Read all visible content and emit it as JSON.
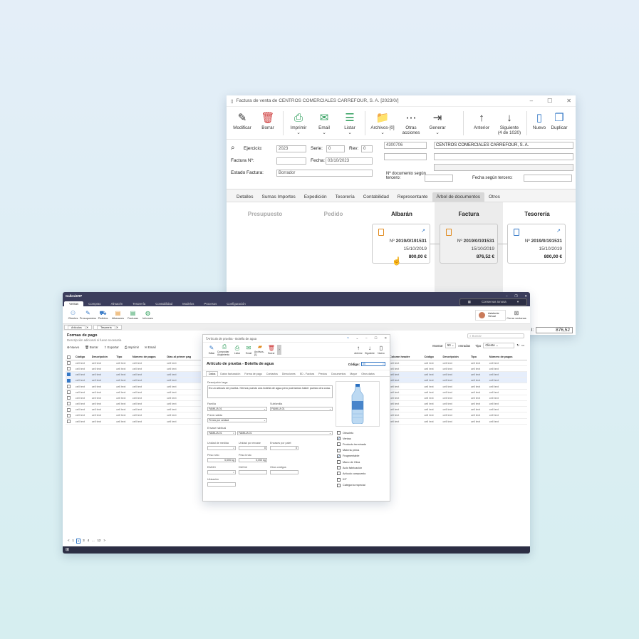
{
  "invoice": {
    "title": "Factura de venta de CENTROS COMERCIALES CARREFOUR, S. A. [2023/0/]",
    "toolbar": [
      {
        "label": "Modificar",
        "icon": "edit-icon",
        "sym": "✎"
      },
      {
        "label": "Borrar",
        "icon": "delete-icon",
        "sym": "🗑"
      },
      {
        "label": "Imprimir",
        "icon": "print-icon",
        "sym": "⎙"
      },
      {
        "label": "Email",
        "icon": "email-icon",
        "sym": "✉"
      },
      {
        "label": "Listar",
        "icon": "list-icon",
        "sym": "☰"
      },
      {
        "label": "Archivos-[0]",
        "icon": "folder-icon",
        "sym": "📁"
      },
      {
        "label": "Otras acciones",
        "icon": "more-icon",
        "sym": "⋯"
      },
      {
        "label": "Generar",
        "icon": "generate-icon",
        "sym": "⇥"
      }
    ],
    "nav": [
      {
        "label": "Anterior",
        "icon": "arrow-up-icon",
        "sym": "↑"
      },
      {
        "label": "Siguiente",
        "icon": "arrow-down-icon",
        "sym": "↓"
      },
      {
        "label": "Nuevo",
        "icon": "new-doc-icon",
        "sym": "▯"
      },
      {
        "label": "Duplicar",
        "icon": "duplicate-icon",
        "sym": "❐"
      }
    ],
    "nav_counter": "(4 de 1020)",
    "form": {
      "ejercicio_label": "Ejercicio:",
      "ejercicio": "2023",
      "serie_label": "Serie:",
      "serie": "0",
      "rev_label": "Rev:",
      "rev": "0",
      "factura_label": "Factura Nº:",
      "factura": "",
      "fecha_label": "Fecha:",
      "fecha": "03/10/2023",
      "estado_label": "Estado Factura:",
      "estado": "Borrador",
      "cliente_code": "4300706",
      "cliente_name": "CENTROS COMERCIALES CARREFOUR, S. A.",
      "ndoc_label": "Nº documento según tercero:",
      "fecha_tercero_label": "Fecha según tercero:"
    },
    "tabs": [
      "Detalles",
      "Sumas Importes",
      "Expedición",
      "Tesorería",
      "Contabilidad",
      "Representante",
      "Árbol de documentos",
      "Otros"
    ],
    "active_tab": "Árbol de documentos",
    "tree": {
      "columns": [
        "Presupuesto",
        "Pedido",
        "Albarán",
        "Factura",
        "Tesorería"
      ],
      "cards": [
        {
          "num_prefix": "Nº ",
          "num": "2019/0/191531",
          "date": "15/10/2019",
          "amount": "800,00 €"
        },
        {
          "num_prefix": "Nº ",
          "num": "2019/0/191531",
          "date": "15/10/2019",
          "amount": "876,52 €"
        },
        {
          "num_prefix": "Nº ",
          "num": "2019/0/191531",
          "date": "15/10/2019",
          "amount": "800,00 €"
        }
      ]
    },
    "total_suffix": "l:",
    "total": "876,52"
  },
  "erp": {
    "app": "GalleniERP",
    "menu": [
      "Ventas",
      "Compras",
      "Almacén",
      "Tesorería",
      "Contabilidad",
      "Modelos",
      "Procesos",
      "Configuración"
    ],
    "ribbon": [
      "Clientes",
      "Presupuestos",
      "Pedidos",
      "Albaranes",
      "Facturas",
      "Informes"
    ],
    "company": "Conservas Ionosa",
    "assistant": "Asistente Virtual",
    "close_label": "Cerrar ventanas",
    "tabs": [
      "Artículos",
      "Tesoreria"
    ],
    "list_title": "Formas de pago",
    "list_subtitle": "Descripción adicional si fuese necesaria",
    "actions": [
      "Nuevo",
      "Borrar",
      "Exportar",
      "Imprimir",
      "Email"
    ],
    "show_label": "Mostrar",
    "show_value": "50",
    "entries_label": "entradas",
    "type_label": "Tipo",
    "type_value": "Cliente",
    "search_placeholder": "Buscar",
    "left_cols": [
      "Código",
      "Descripción",
      "Tipo",
      "Número de pagos",
      "Días al primer pag"
    ],
    "right_cols": [
      "Column header",
      "Código",
      "Descripción",
      "Tipo",
      "Número de pagos"
    ],
    "cell": "cell text",
    "rows": [
      false,
      false,
      true,
      true,
      false,
      false,
      false,
      false,
      false,
      false,
      false
    ],
    "pagination": [
      "<",
      "1",
      "2",
      "3",
      "4",
      "...",
      "12",
      ">"
    ]
  },
  "article": {
    "title": "Artículo de prueba - Botella de agua",
    "toolbar": [
      "Editar",
      "Comprobar Alojamiento",
      "Listar",
      "Email",
      "Archivos-[1]",
      "Borrar"
    ],
    "nav": [
      "Anterior",
      "Siguiente",
      "Nuevo"
    ],
    "heading": "Artículo de prueba - Botella de agua",
    "code_label": "Código:",
    "code": "55",
    "tabs": [
      "Datos",
      "Datos facturación",
      "Forma de pago",
      "Contactos",
      "Direcciones",
      "ED - Factura",
      "Precios",
      "Documentos",
      "Mayor",
      "Otros datos"
    ],
    "desc_label": "Descripción larga",
    "desc": "Es un artículo de prueba. Hemos puesto una botella de agua pero podríamos haber puesto otra cosa.",
    "familia_label": "Familia",
    "familia": "FAMILIA 01",
    "subfamilia_label": "Subfamilia",
    "subfamilia": "FAMILIA 01",
    "precio_label": "Precio salida",
    "precio": "Precio por unidad",
    "envase_label": "Envase habitual",
    "envase_code": "FAMILIA 01",
    "envase_name": "FAMILIA 01",
    "um_label": "Unidad de medida",
    "upe_label": "Unidad por envase",
    "epp_label": "Envases por palet",
    "upe_val": "0",
    "epp_val": "0",
    "pneto_label": "Peso neto",
    "pneto": "0,000 kg",
    "pbruto_label": "Peso bruto",
    "pbruto": "0,000 kg",
    "ean_label": "EAN13",
    "dun_label": "DUN14",
    "otros_label": "Otros códigos",
    "ubic_label": "Ubicación",
    "checks": [
      {
        "label": "Obsoleto",
        "on": false
      },
      {
        "label": "Ventas",
        "on": true
      },
      {
        "label": "Producto terminado",
        "on": false
      },
      {
        "label": "Materia prima",
        "on": false
      },
      {
        "label": "Fragmentable",
        "on": true
      },
      {
        "label": "Mano de Obra",
        "on": false
      },
      {
        "label": "Auto fabricación",
        "on": false
      },
      {
        "label": "Artículo compuesto",
        "on": false
      },
      {
        "label": "KIT",
        "on": false
      },
      {
        "label": "Categoría especial",
        "on": false
      }
    ]
  },
  "colors": {
    "accent": "#3478c6",
    "orange": "#e08a1e",
    "dark": "#3b3d5c"
  }
}
